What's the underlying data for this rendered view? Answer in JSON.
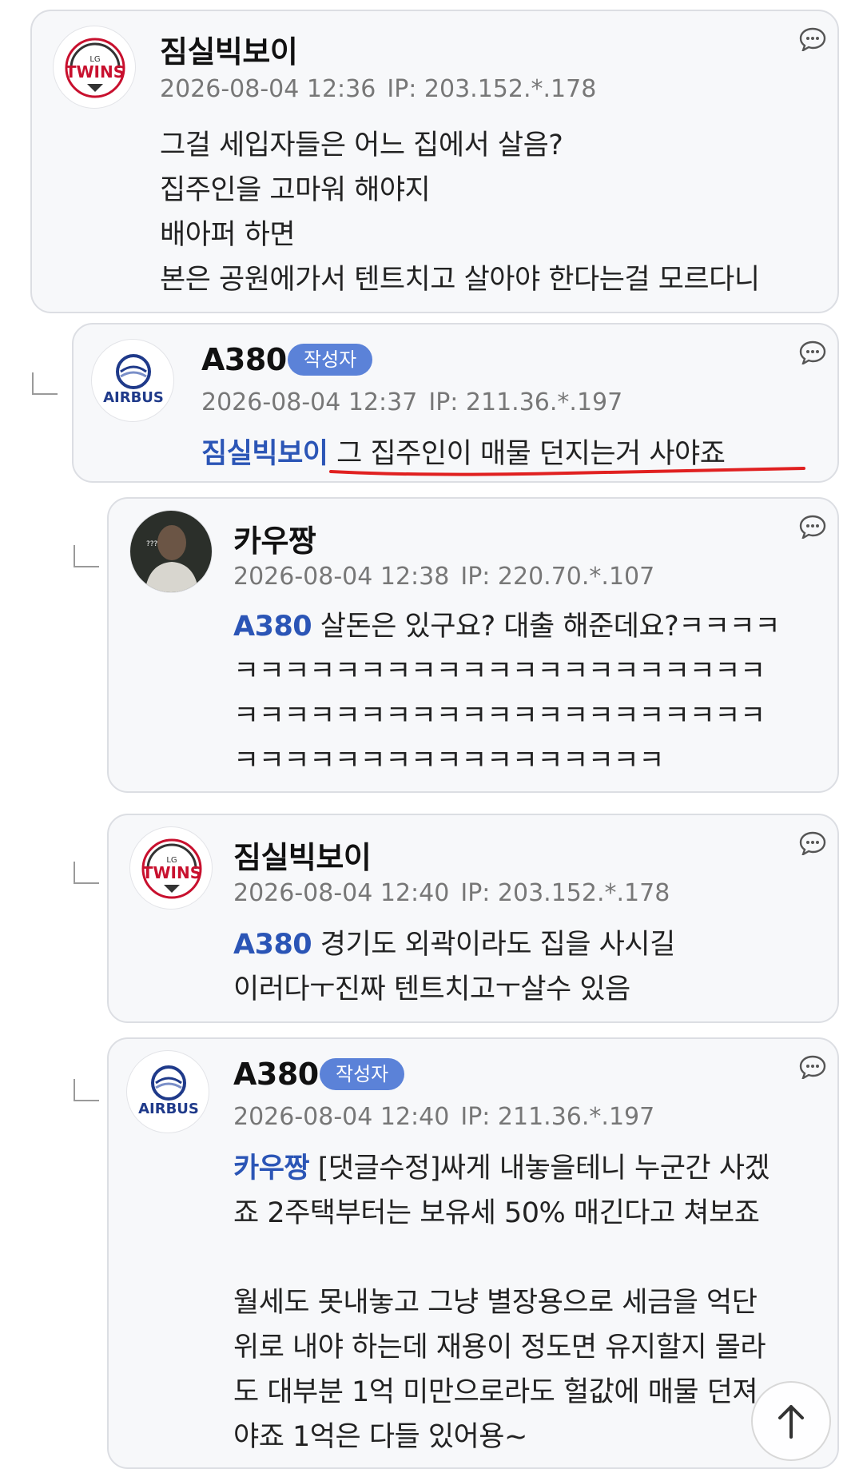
{
  "comments": [
    {
      "nickname": "짐실빅보이",
      "date": "2026-08-04 12:36",
      "ip": "IP: 203.152.*.178",
      "avatar": "lg-twins-logo",
      "avatar_text": {
        "top": "LG",
        "main": "TWINS"
      },
      "lines": [
        "그걸 세입자들은 어느 집에서 살음?",
        "집주인을 고마워 해야지",
        "배아퍼 하면",
        "본은 공원에가서 텐트치고 살아야 한다는걸 모르다니"
      ]
    },
    {
      "nickname": "A380",
      "badge": "작성자",
      "date": "2026-08-04 12:37",
      "ip": "IP: 211.36.*.197",
      "avatar": "airbus-logo",
      "avatar_text": {
        "main": "AIRBUS"
      },
      "mention": "짐실빅보이",
      "lines": [
        "그 집주인이 매물 던지는거 사야죠"
      ]
    },
    {
      "nickname": "카우짱",
      "date": "2026-08-04 12:38",
      "ip": "IP: 220.70.*.107",
      "avatar": "person-photo",
      "avatar_text": {
        "marks": "???"
      },
      "mention": "A380",
      "lines": [
        "살돈은 있구요? 대출 해준데요?ㅋㅋㅋㅋ",
        "ㅋㅋㅋㅋㅋㅋㅋㅋㅋㅋㅋㅋㅋㅋㅋㅋㅋㅋㅋㅋㅋ",
        "ㅋㅋㅋㅋㅋㅋㅋㅋㅋㅋㅋㅋㅋㅋㅋㅋㅋㅋㅋㅋㅋ",
        "ㅋㅋㅋㅋㅋㅋㅋㅋㅋㅋㅋㅋㅋㅋㅋㅋㅋ"
      ]
    },
    {
      "nickname": "짐실빅보이",
      "date": "2026-08-04 12:40",
      "ip": "IP: 203.152.*.178",
      "avatar": "lg-twins-logo",
      "avatar_text": {
        "top": "LG",
        "main": "TWINS"
      },
      "mention": "A380",
      "lines": [
        "경기도 외곽이라도 집을 사시길",
        "이러다ㅜ진짜 텐트치고ㅜ살수 있음"
      ]
    },
    {
      "nickname": "A380",
      "badge": "작성자",
      "date": "2026-08-04 12:40",
      "ip": "IP: 211.36.*.197",
      "avatar": "airbus-logo",
      "avatar_text": {
        "main": "AIRBUS"
      },
      "mention": "카우짱",
      "lines": [
        "[댓글수정]싸게 내놓을테니 누군간 사겠",
        "죠 2주택부터는 보유세 50% 매긴다고 쳐보죠",
        "",
        "월세도 못내놓고 그냥 별장용으로 세금을 억단",
        "위로 내야 하는데 재용이 정도면 유지할지 몰라",
        "도 대부분 1억 미만으로라도 헐값에 매물 던져",
        "야죠 1억은 다들 있어용~"
      ]
    }
  ],
  "colors": {
    "mention": "#2b55b6",
    "badge": "#5b82d8",
    "underline": "#e02020",
    "card_bg": "#f7f8fa",
    "lg_red": "#c8102e"
  },
  "icons": {
    "reply": "comment-bubble-icon",
    "scroll_top": "arrow-up-icon",
    "thread": "reply-branch-icon"
  }
}
